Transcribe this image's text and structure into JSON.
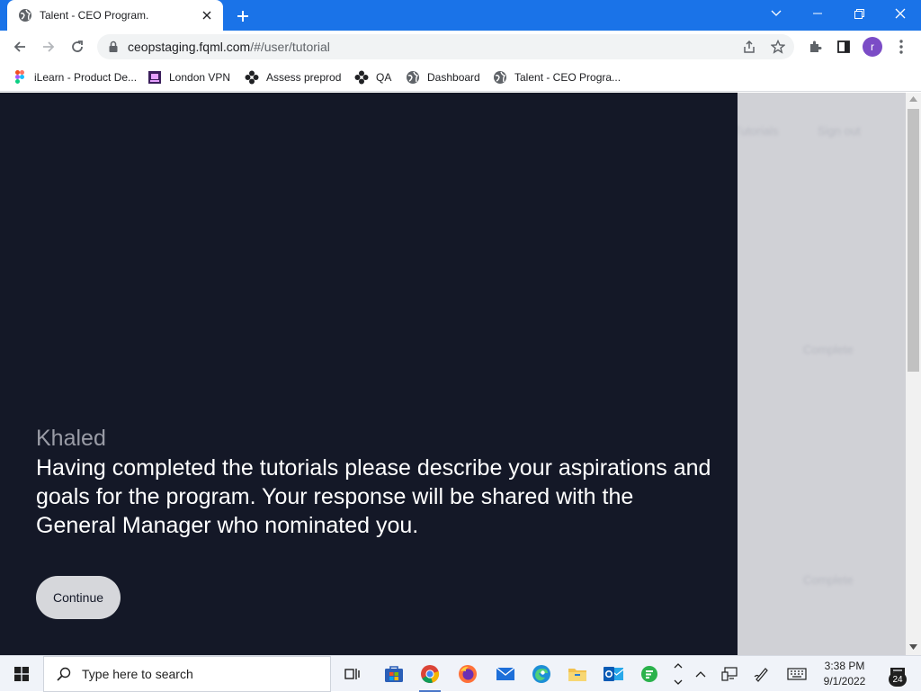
{
  "browser": {
    "tab": {
      "title": "Talent - CEO Program."
    },
    "address": {
      "host": "ceopstaging.fqml.com",
      "path": "/#/user/tutorial"
    },
    "profile_initial": "r",
    "bookmarks": [
      {
        "label": "iLearn - Product De...",
        "icon": "figma-icon"
      },
      {
        "label": "London VPN",
        "icon": "vpn-icon"
      },
      {
        "label": "Assess preprod",
        "icon": "flower-icon"
      },
      {
        "label": "QA",
        "icon": "flower-icon"
      },
      {
        "label": "Dashboard",
        "icon": "globe-icon"
      },
      {
        "label": "Talent - CEO Progra...",
        "icon": "globe-icon"
      }
    ]
  },
  "page": {
    "background_nav": {
      "tutorials": "Tutorials",
      "sign_out": "Sign out"
    },
    "background_status": [
      "Complete",
      "Complete"
    ],
    "dialog": {
      "speaker": "Khaled",
      "message": "Having completed the tutorials please describe your aspirations and goals for the program. Your response will be shared with the General Manager who nominated you.",
      "continue_label": "Continue"
    },
    "colors": {
      "panel": "#141827",
      "button": "#d6d7db",
      "browser_accent": "#1a73e8"
    }
  },
  "taskbar": {
    "search_placeholder": "Type here to search",
    "time": "3:38 PM",
    "date": "9/1/2022",
    "notification_count": "24"
  }
}
